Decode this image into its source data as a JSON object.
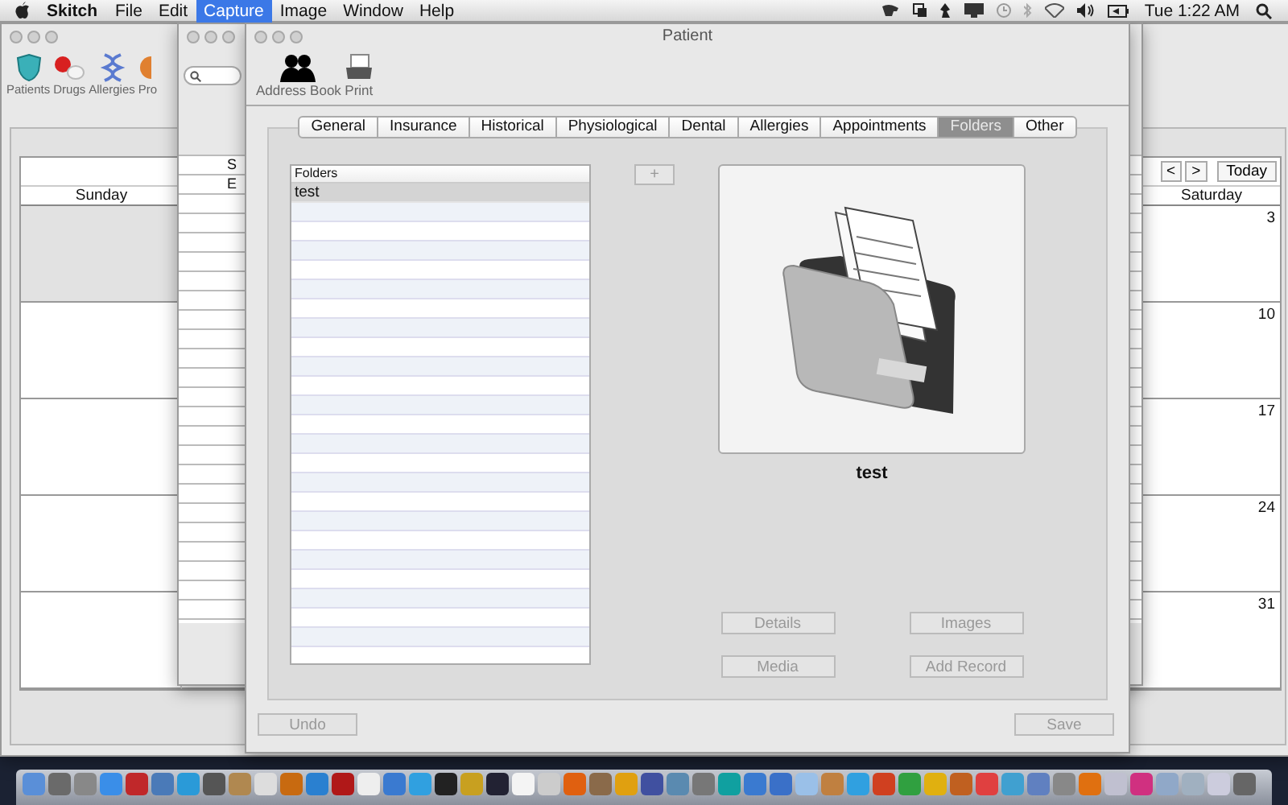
{
  "menu_bar": {
    "app_name": "Skitch",
    "items": [
      {
        "label": "File",
        "selected": false
      },
      {
        "label": "Edit",
        "selected": false
      },
      {
        "label": "Capture",
        "selected": true
      },
      {
        "label": "Image",
        "selected": false
      },
      {
        "label": "Window",
        "selected": false
      },
      {
        "label": "Help",
        "selected": false
      }
    ],
    "clock": "Tue 1:22 AM"
  },
  "main_window": {
    "toolbar": [
      {
        "label": "Patients",
        "kind": "shield"
      },
      {
        "label": "Drugs",
        "kind": "pills"
      },
      {
        "label": "Allergies",
        "kind": "dna"
      },
      {
        "label": "Pro",
        "kind": "partial"
      }
    ],
    "calendar": {
      "nav_buttons": [
        "<",
        ">",
        "Today"
      ],
      "day_headers": [
        "Sunday",
        "Saturday"
      ],
      "weeks": [
        {
          "sunday_outside_month": true,
          "saturday_date": "3"
        },
        {
          "sunday_outside_month": false,
          "saturday_date": "10"
        },
        {
          "sunday_outside_month": false,
          "saturday_date": "17"
        },
        {
          "sunday_outside_month": false,
          "saturday_date": "24"
        },
        {
          "sunday_outside_month": false,
          "saturday_date": "31"
        }
      ]
    }
  },
  "list_window": {
    "column_1_header": "S",
    "rows": [
      "E"
    ]
  },
  "patient_window": {
    "title": "Patient",
    "toolbar": [
      {
        "label": "Address Book",
        "kind": "people"
      },
      {
        "label": "Print",
        "kind": "printer"
      }
    ],
    "tabs": [
      {
        "label": "General",
        "selected": false
      },
      {
        "label": "Insurance",
        "selected": false
      },
      {
        "label": "Historical",
        "selected": false
      },
      {
        "label": "Physiological",
        "selected": false
      },
      {
        "label": "Dental",
        "selected": false
      },
      {
        "label": "Allergies",
        "selected": false
      },
      {
        "label": "Appointments",
        "selected": false
      },
      {
        "label": "Folders",
        "selected": true
      },
      {
        "label": "Other",
        "selected": false
      }
    ],
    "folders_table": {
      "header": "Folders",
      "rows": [
        {
          "name": "test",
          "selected": true
        }
      ]
    },
    "add_button": {
      "label": "+",
      "disabled": true
    },
    "preview_caption": "test",
    "actions": [
      {
        "label": "Details",
        "disabled": true
      },
      {
        "label": "Images",
        "disabled": true
      },
      {
        "label": "Media",
        "disabled": true
      },
      {
        "label": "Add Record",
        "disabled": true
      }
    ],
    "undo_button": {
      "label": "Undo",
      "disabled": true
    },
    "save_button": {
      "label": "Save",
      "disabled": true
    }
  }
}
